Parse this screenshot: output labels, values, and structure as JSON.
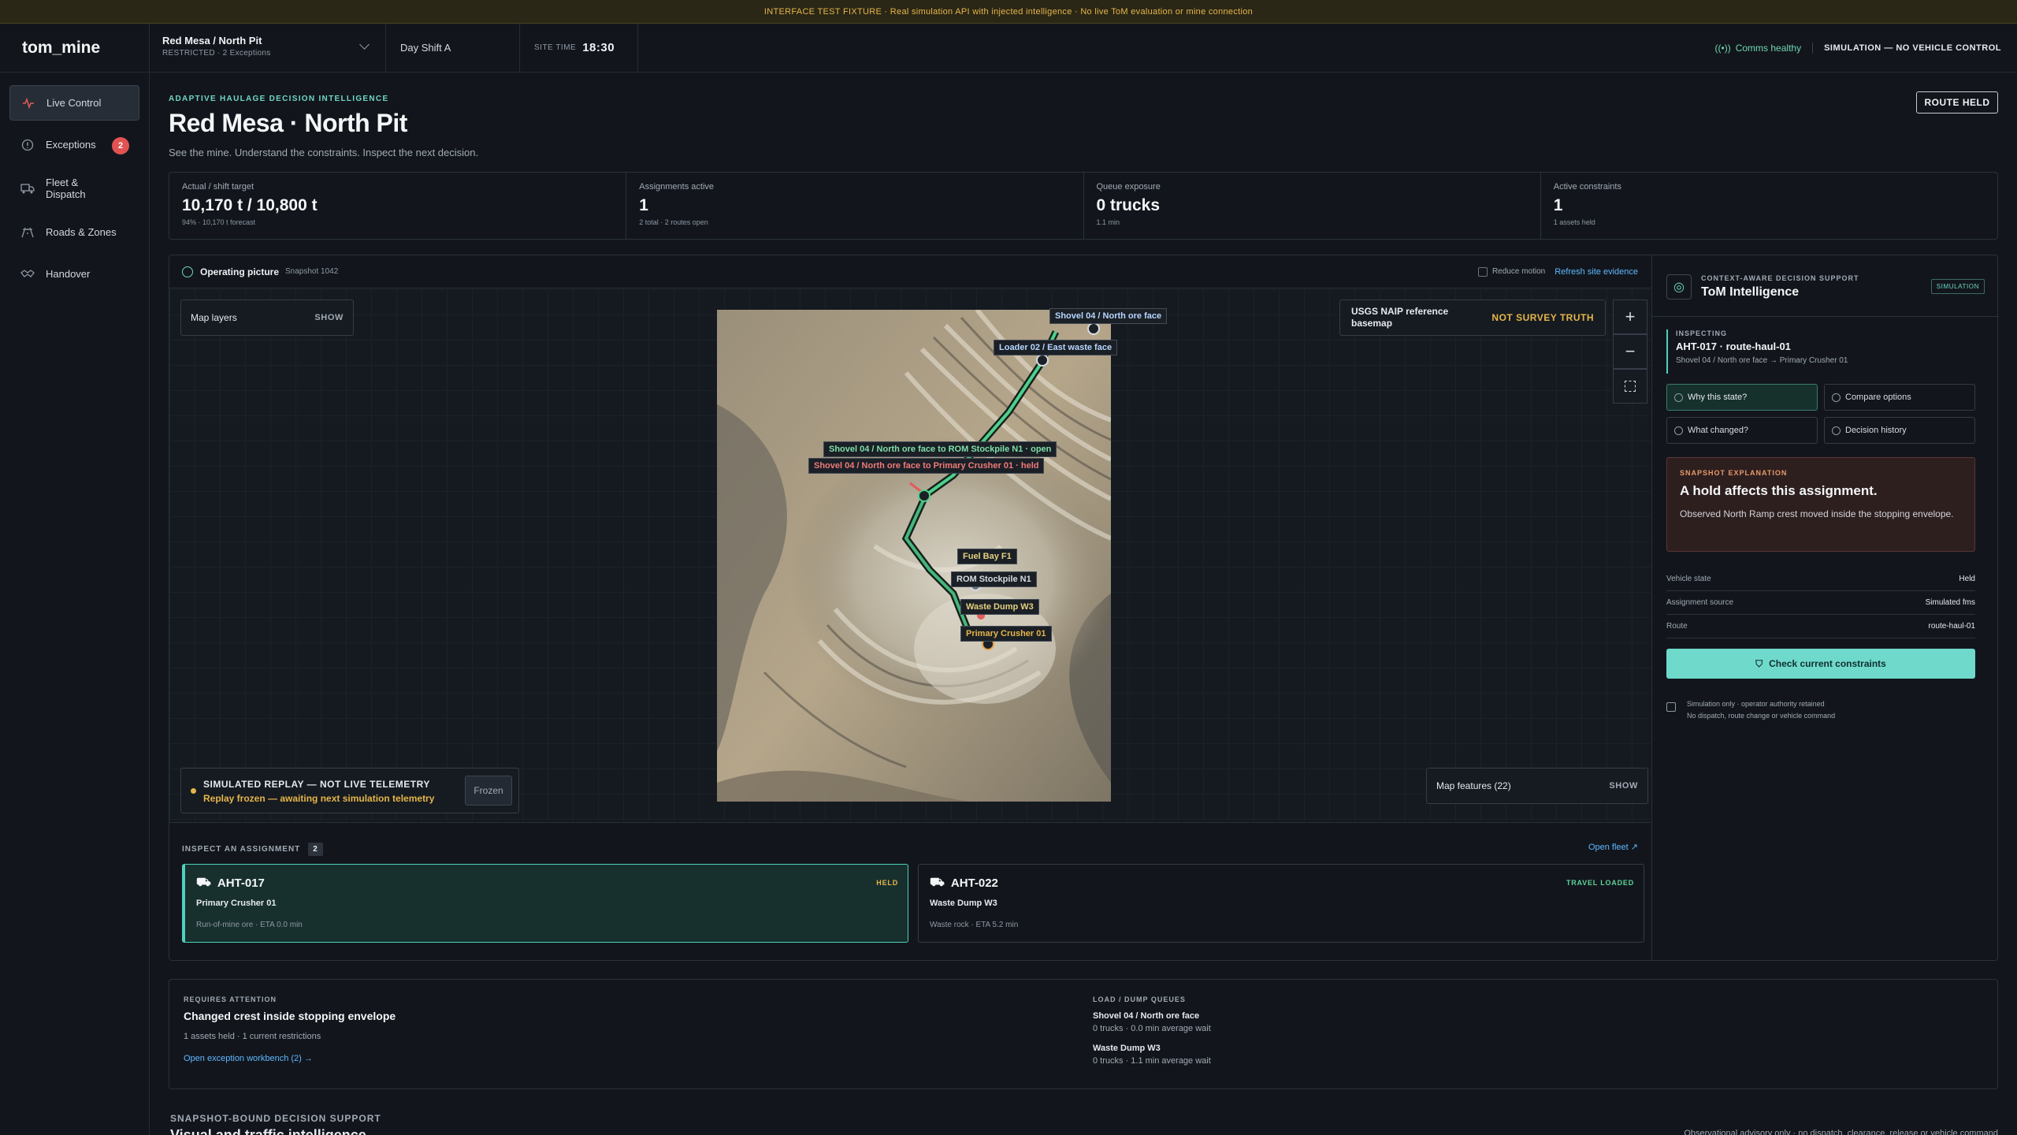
{
  "banner": "INTERFACE TEST FIXTURE · Real simulation API with injected intelligence · No live ToM evaluation or mine connection",
  "brand": "tom_mine",
  "site_selector": {
    "name": "Red Mesa / North Pit",
    "meta": "RESTRICTED · 2 Exceptions"
  },
  "shift": "Day Shift A",
  "site_time": {
    "label": "SITE TIME",
    "value": "18:30"
  },
  "comms": "Comms healthy",
  "sim_mode": "SIMULATION — NO VEHICLE CONTROL",
  "nav": [
    {
      "label": "Live Control",
      "icon": "pulse-icon"
    },
    {
      "label": "Exceptions",
      "icon": "alert-circle-icon",
      "badge": "2"
    },
    {
      "label": "Fleet &\nDispatch",
      "icon": "truck-icon"
    },
    {
      "label": "Roads & Zones",
      "icon": "road-icon"
    },
    {
      "label": "Handover",
      "icon": "handshake-icon"
    }
  ],
  "header": {
    "eyebrow": "ADAPTIVE HAULAGE DECISION INTELLIGENCE",
    "title": "Red Mesa · North Pit",
    "subtitle": "See the mine. Understand the constraints. Inspect the next decision.",
    "status_button": "ROUTE HELD"
  },
  "stats": [
    {
      "label": "Actual / shift target",
      "value": "10,170 t / 10,800 t",
      "sub": "94% · 10,170 t forecast"
    },
    {
      "label": "Assignments active",
      "value": "1",
      "sub": "2 total · 2 routes open"
    },
    {
      "label": "Queue exposure",
      "value": "0 trucks",
      "sub": "1.1 min"
    },
    {
      "label": "Active constraints",
      "value": "1",
      "sub": "1 assets held"
    }
  ],
  "operating": {
    "title": "Operating picture",
    "snapshot": "Snapshot 1042",
    "reduce_motion": "Reduce motion",
    "refresh": "Refresh site evidence",
    "map_layers": "Map layers",
    "show": "SHOW",
    "basemap": "USGS NAIP reference basemap",
    "basemap_flag": "NOT SURVEY TRUTH",
    "map_features": "Map features (22)",
    "replay_title": "SIMULATED REPLAY — NOT LIVE TELEMETRY",
    "replay_status": "Replay frozen — awaiting next simulation telemetry",
    "replay_button": "Frozen",
    "map_labels": {
      "shovel": "Shovel 04 / North ore face",
      "loader": "Loader 02 / East waste face",
      "route_open": "Shovel 04 / North ore face to ROM Stockpile N1 · open",
      "route_held": "Shovel 04 / North ore face to Primary Crusher 01 · held",
      "fuel": "Fuel Bay F1",
      "rom": "ROM Stockpile N1",
      "dump": "Waste Dump W3",
      "crusher": "Primary Crusher 01"
    }
  },
  "inspect": {
    "title": "INSPECT AN ASSIGNMENT",
    "count": "2",
    "open_fleet": "Open fleet ↗",
    "cards": [
      {
        "id": "AHT-017",
        "status": "HELD",
        "status_color": "#e5b54a",
        "dest": "Primary Crusher 01",
        "note": "Run-of-mine ore · ETA 0.0 min"
      },
      {
        "id": "AHT-022",
        "status": "TRAVEL LOADED",
        "status_color": "#5fd39a",
        "dest": "Waste Dump W3",
        "note": "Waste rock · ETA 5.2 min"
      }
    ]
  },
  "tom": {
    "eyebrow": "CONTEXT-AWARE DECISION SUPPORT",
    "title": "ToM Intelligence",
    "badge": "SIMULATION",
    "inspecting_label": "INSPECTING",
    "inspecting_id": "AHT-017 · route-haul-01",
    "inspecting_route": "Shovel 04 / North ore face → Primary Crusher 01",
    "buttons": [
      "Why this state?",
      "Compare options",
      "What changed?",
      "Decision history"
    ],
    "explanation_label": "SNAPSHOT EXPLANATION",
    "explanation_title": "A hold affects this assignment.",
    "explanation_body": "Observed North Ramp crest moved inside the stopping envelope.",
    "kv": [
      {
        "k": "Vehicle state",
        "v": "Held"
      },
      {
        "k": "Assignment source",
        "v": "Simulated fms"
      },
      {
        "k": "Route",
        "v": "route-haul-01"
      }
    ],
    "check_button": "Check current constraints",
    "note1": "Simulation only · operator authority retained",
    "note2": "No dispatch, route change or vehicle command"
  },
  "attention": {
    "eyebrow": "REQUIRES ATTENTION",
    "title": "Changed crest inside stopping envelope",
    "sub": "1 assets held · 1 current restrictions",
    "link": "Open exception workbench (2) →",
    "queues_label": "LOAD / DUMP QUEUES",
    "queues": [
      {
        "name": "Shovel 04 / North ore face",
        "detail": "0 trucks · 0.0 min average wait"
      },
      {
        "name": "Waste Dump W3",
        "detail": "0 trucks · 1.1 min average wait"
      }
    ]
  },
  "footer": {
    "eyebrow": "SNAPSHOT-BOUND DECISION SUPPORT",
    "title": "Visual and traffic intelligence",
    "right": "Observational advisory only · no dispatch, clearance, release or vehicle command"
  }
}
